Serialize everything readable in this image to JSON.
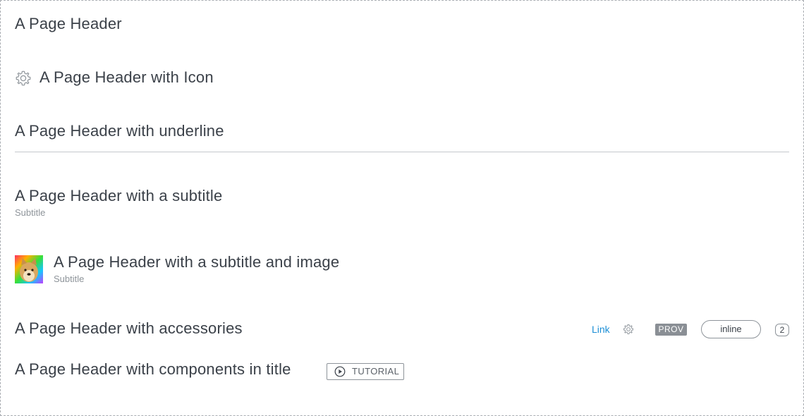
{
  "headers": {
    "plain": {
      "title": "A Page Header"
    },
    "with_icon": {
      "title": "A Page Header with Icon",
      "icon": "gear-icon"
    },
    "with_underline": {
      "title": "A Page Header with underline"
    },
    "with_subtitle": {
      "title": "A Page Header with a subtitle",
      "subtitle": "Subtitle"
    },
    "with_image": {
      "title": "A Page Header with a subtitle and image",
      "subtitle": "Subtitle",
      "image": "doge-avatar"
    },
    "with_accessories": {
      "title": "A Page Header with accessories",
      "link_label": "Link",
      "settings_icon": "gear-icon",
      "badge_label": "PROV",
      "inline_button_label": "inline",
      "count": "2"
    },
    "with_components": {
      "title": "A Page Header with components in title",
      "tutorial_label": "TUTORIAL",
      "tutorial_icon": "play-circle-icon"
    }
  },
  "colors": {
    "text": "#3b4149",
    "subtitle": "#8e949a",
    "link": "#1d8fd6",
    "badge_bg": "#8a8f95",
    "rule": "#c4c8cc"
  }
}
